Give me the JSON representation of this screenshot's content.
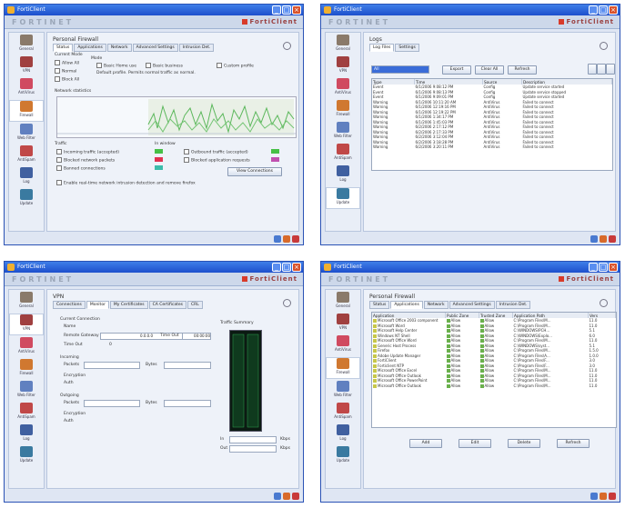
{
  "window1": {
    "title": "FortiClient",
    "page_title": "Personal Firewall",
    "tabs": [
      "Status",
      "Applications",
      "Network",
      "Advanced Settings",
      "Intrusion Det."
    ],
    "current_mode_label": "Current Mode",
    "mode_label": "Mode",
    "allow_all": "Allow All",
    "normal": "Normal",
    "block_all": "Block All",
    "mode_opts": [
      "Basic Home use",
      "Basic business",
      "Custom profile"
    ],
    "mode_desc": "Default profile. Permits normal traffic as normal.",
    "network_stats_label": "Network statistics",
    "traffic_label": "Traffic",
    "in_window_label": "In window",
    "legend": [
      "Incoming traffic (accepted)",
      "Blocked network packets",
      "Outbound traffic (accepted)",
      "Blocked application requests",
      "Banned connections"
    ],
    "enable_label": "Enable real-time network intrusion detection and remove firefox",
    "button": "View Connections"
  },
  "window2": {
    "title": "FortiClient",
    "page_title": "Logs",
    "tabs": [
      "Log Files",
      "Settings"
    ],
    "filter_value": "All",
    "buttons": [
      "Export",
      "Clear All",
      "Refresh"
    ],
    "columns": [
      "Type",
      "Time",
      "Source",
      "Description"
    ],
    "rows": [
      [
        "Event",
        "6/1/2006 9:08:12 PM",
        "Config",
        "Update service started"
      ],
      [
        "Event",
        "6/1/2006 9:08:13 PM",
        "Config",
        "Update service stopped"
      ],
      [
        "Event",
        "6/1/2006 9:09:01 PM",
        "Config",
        "Update service started"
      ],
      [
        "Warning",
        "6/1/2006 10:11:20 AM",
        "AntiVirus",
        "Failed to connect"
      ],
      [
        "Warning",
        "6/1/2006 12:19:16 PM",
        "AntiVirus",
        "Failed to connect"
      ],
      [
        "Warning",
        "6/1/2006 12:19:22 PM",
        "AntiVirus",
        "Failed to connect"
      ],
      [
        "Warning",
        "6/1/2006 1:34:17 PM",
        "AntiVirus",
        "Failed to connect"
      ],
      [
        "Warning",
        "6/1/2006 1:45:03 PM",
        "AntiVirus",
        "Failed to connect"
      ],
      [
        "Warning",
        "6/2/2006 2:17:12 PM",
        "AntiVirus",
        "Failed to connect"
      ],
      [
        "Warning",
        "6/2/2006 2:17:33 PM",
        "AntiVirus",
        "Failed to connect"
      ],
      [
        "Warning",
        "6/2/2006 3:12:04 PM",
        "AntiVirus",
        "Failed to connect"
      ],
      [
        "Warning",
        "6/2/2006 3:18:28 PM",
        "AntiVirus",
        "Failed to connect"
      ],
      [
        "Warning",
        "6/2/2006 3:20:11 PM",
        "AntiVirus",
        "Failed to connect"
      ]
    ]
  },
  "window3": {
    "title": "FortiClient",
    "page_title": "VPN",
    "tabs": [
      "Connections",
      "Monitor",
      "My Certificates",
      "CA Certificates",
      "CRL"
    ],
    "current_connection": "Current Connection",
    "name_label": "Name",
    "remote_gateway": "Remote Gateway",
    "remote_ip": "0.0.0.0",
    "time_out": "Time Out",
    "time_val": "0",
    "bytes": "00:00:00",
    "incoming": "Incoming",
    "packets": "Packets",
    "bytes_label": "Bytes",
    "encryption": "Encryption",
    "outgoing": "Outgoing",
    "auth": "Auth",
    "traffic_summary": "Traffic Summary",
    "in_label": "In",
    "out_label": "Out",
    "kbps": "Kbps"
  },
  "window4": {
    "title": "FortiClient",
    "page_title": "Personal Firewall",
    "tabs": [
      "Status",
      "Applications",
      "Network",
      "Advanced Settings",
      "Intrusion Det."
    ],
    "columns": [
      "Application",
      "Public Zone",
      "Trusted Zone",
      "Application Path",
      "Vers"
    ],
    "rows": [
      [
        "Microsoft Office 2003 component",
        "Allow",
        "Allow",
        "C:\\Program Files\\M...",
        "11.0"
      ],
      [
        "Microsoft Word",
        "Allow",
        "Allow",
        "C:\\Program Files\\M...",
        "11.0"
      ],
      [
        "Microsoft Help Center",
        "Allow",
        "Allow",
        "C:\\WINDOWS\\PCH...",
        "5.1"
      ],
      [
        "Windows NT Shell",
        "Allow",
        "Allow",
        "C:\\WINDOWS\\Explo...",
        "6.0"
      ],
      [
        "Microsoft Office Word",
        "Allow",
        "Allow",
        "C:\\Program Files\\M...",
        "11.0"
      ],
      [
        "Generic Host Process",
        "Allow",
        "Allow",
        "C:\\WINDOWS\\syst...",
        "5.1"
      ],
      [
        "Firefox",
        "Allow",
        "Allow",
        "C:\\Program Files\\M...",
        "1.5.0"
      ],
      [
        "Adobe Update Manager",
        "Allow",
        "Allow",
        "C:\\Program Files\\A...",
        "1.0.0"
      ],
      [
        "FortiClient",
        "Allow",
        "Allow",
        "C:\\Program Files\\F...",
        "3.0"
      ],
      [
        "Forticlient NTP",
        "Allow",
        "Allow",
        "C:\\Program Files\\F...",
        "3.0"
      ],
      [
        "Microsoft Office Excel",
        "Allow",
        "Allow",
        "C:\\Program Files\\M...",
        "11.0"
      ],
      [
        "Microsoft Office Outlook",
        "Allow",
        "Allow",
        "C:\\Program Files\\M...",
        "11.0"
      ],
      [
        "Microsoft Office PowerPoint",
        "Allow",
        "Allow",
        "C:\\Program Files\\M...",
        "11.0"
      ],
      [
        "Microsoft Office Outlook",
        "Allow",
        "Allow",
        "C:\\Program Files\\M...",
        "11.0"
      ]
    ],
    "buttons": [
      "Add",
      "Edit",
      "Delete",
      "Refresh"
    ]
  },
  "nav": [
    "General",
    "VPN",
    "AntiVirus",
    "Firewall",
    "Web Filter",
    "AntiSpam",
    "Log",
    "Update"
  ],
  "brand": {
    "left": "FORTINET",
    "right": "FortiClient"
  }
}
